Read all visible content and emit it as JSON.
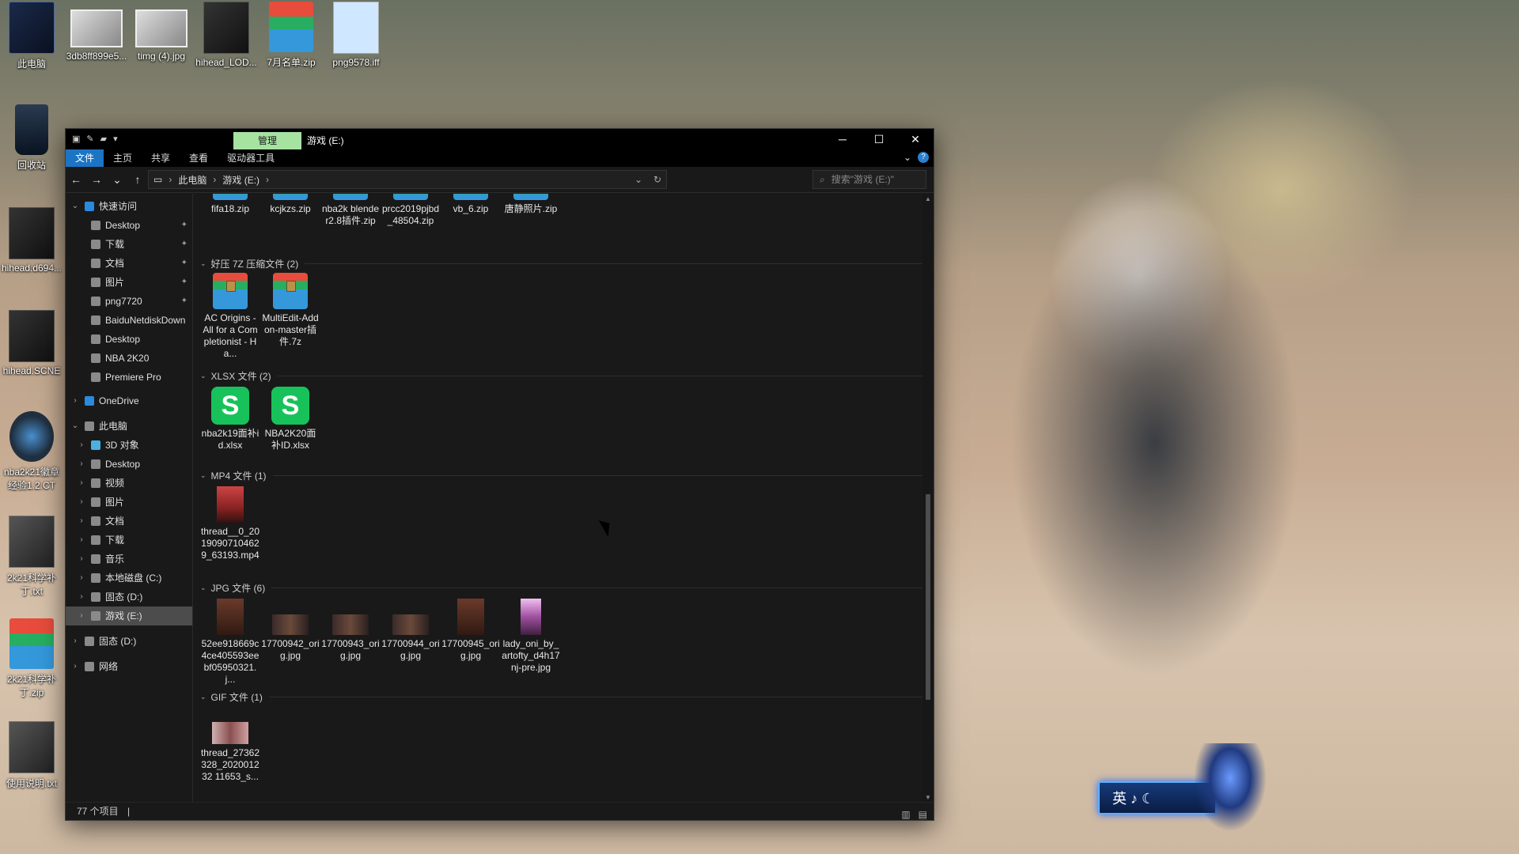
{
  "desktop_icons": [
    {
      "label": "此电脑",
      "type": "pc"
    },
    {
      "label": "3db8ff899e5...",
      "type": "photo"
    },
    {
      "label": "timg (4).jpg",
      "type": "photo"
    },
    {
      "label": "hihead_LOD...",
      "type": "dark"
    },
    {
      "label": "7月名单.zip",
      "type": "rar"
    },
    {
      "label": "png9578.iff",
      "type": "pic"
    },
    {
      "label": "回收站",
      "type": "bin"
    },
    {
      "label": "hihead.d694...",
      "type": "dark"
    },
    {
      "label": "hihead.SCNE",
      "type": "dark"
    },
    {
      "label": "nba2k21徽章经验1.2.CT",
      "type": "cfg"
    },
    {
      "label": "2k21科学补丁.txt",
      "type": "txt"
    },
    {
      "label": "2k21科学补丁.zip",
      "type": "rar"
    },
    {
      "label": "使用说明.txt",
      "type": "txt"
    }
  ],
  "window": {
    "manage_tab": "管理",
    "title": "游戏 (E:)",
    "minimize": "─",
    "maximize": "☐",
    "close": "✕"
  },
  "ribbon": {
    "tabs": [
      "文件",
      "主页",
      "共享",
      "查看",
      "驱动器工具"
    ],
    "expand": "⌄",
    "help": "?"
  },
  "nav_buttons": {
    "back": "←",
    "forward": "→",
    "recent": "⌄",
    "up": "↑"
  },
  "address": {
    "crumbs": [
      "此电脑",
      "游戏 (E:)"
    ],
    "sep": "›",
    "drop": "⌄",
    "refresh": "↻"
  },
  "search": {
    "placeholder": "搜索\"游戏 (E:)\"",
    "icon": "⌕"
  },
  "nav_pane": [
    {
      "label": "快速访问",
      "level": 0,
      "expanded": true,
      "pin": false
    },
    {
      "label": "Desktop",
      "level": 1,
      "pin": true
    },
    {
      "label": "下载",
      "level": 1,
      "pin": true
    },
    {
      "label": "文档",
      "level": 1,
      "pin": true
    },
    {
      "label": "图片",
      "level": 1,
      "pin": true
    },
    {
      "label": "png7720",
      "level": 1,
      "pin": true
    },
    {
      "label": "BaiduNetdiskDown",
      "level": 1,
      "pin": false
    },
    {
      "label": "Desktop",
      "level": 1,
      "pin": false
    },
    {
      "label": "NBA 2K20",
      "level": 1,
      "pin": false
    },
    {
      "label": "Premiere Pro",
      "level": 1,
      "pin": false
    },
    {
      "label": "OneDrive",
      "level": 0,
      "expanded": false
    },
    {
      "label": "此电脑",
      "level": 0,
      "expanded": true
    },
    {
      "label": "3D 对象",
      "level": 1
    },
    {
      "label": "Desktop",
      "level": 1
    },
    {
      "label": "视频",
      "level": 1
    },
    {
      "label": "图片",
      "level": 1
    },
    {
      "label": "文档",
      "level": 1
    },
    {
      "label": "下载",
      "level": 1
    },
    {
      "label": "音乐",
      "level": 1
    },
    {
      "label": "本地磁盘 (C:)",
      "level": 1
    },
    {
      "label": "固态 (D:)",
      "level": 1
    },
    {
      "label": "游戏 (E:)",
      "level": 1,
      "selected": true
    },
    {
      "label": "固态 (D:)",
      "level": 0,
      "expanded": false
    },
    {
      "label": "网络",
      "level": 0,
      "expanded": false
    }
  ],
  "groups": [
    {
      "header": "",
      "items": [
        {
          "name": "fifa18.zip",
          "icon": "rar-top"
        },
        {
          "name": "kcjkzs.zip",
          "icon": "rar-top"
        },
        {
          "name": "nba2k blender2.8插件.zip",
          "icon": "rar-top"
        },
        {
          "name": "prcc2019pjbd_48504.zip",
          "icon": "rar-top"
        },
        {
          "name": "vb_6.zip",
          "icon": "rar-top"
        },
        {
          "name": "唐静照片.zip",
          "icon": "rar-top"
        }
      ]
    },
    {
      "header": "好压 7Z 压缩文件 (2)",
      "items": [
        {
          "name": "AC Origins - All for a Completionist - Ha...",
          "icon": "rar"
        },
        {
          "name": "MultiEdit-Addon-master插件.7z",
          "icon": "rar"
        }
      ]
    },
    {
      "header": "XLSX 文件 (2)",
      "items": [
        {
          "name": "nba2k19面补id.xlsx",
          "icon": "xlsx"
        },
        {
          "name": "NBA2K20面补ID.xlsx",
          "icon": "xlsx"
        }
      ]
    },
    {
      "header": "MP4 文件 (1)",
      "items": [
        {
          "name": "thread__0_20190907104629_63193.mp4",
          "icon": "thumb"
        }
      ]
    },
    {
      "header": "JPG 文件 (6)",
      "items": [
        {
          "name": "52ee918669c4ce405593eebf05950321.j...",
          "icon": "thumb-dark"
        },
        {
          "name": "17700942_orig.jpg",
          "icon": "thumb-wide"
        },
        {
          "name": "17700943_orig.jpg",
          "icon": "thumb-wide"
        },
        {
          "name": "17700944_orig.jpg",
          "icon": "thumb-wide"
        },
        {
          "name": "17700945_orig.jpg",
          "icon": "thumb-dark"
        },
        {
          "name": "lady_oni_by_artofty_d4h17nj-pre.jpg",
          "icon": "thumb-pink"
        }
      ]
    },
    {
      "header": "GIF 文件 (1)",
      "items": [
        {
          "name": "thread_27362328_202001232 11653_s...",
          "icon": "thumb-gif"
        }
      ]
    }
  ],
  "file_icon_glyphs": {
    "xlsx": "S"
  },
  "status": {
    "count": "77 个项目",
    "sep": "|"
  },
  "ime": {
    "text": "英 ♪ ☾"
  },
  "scroll": {
    "up": "▲",
    "down": "▼"
  }
}
